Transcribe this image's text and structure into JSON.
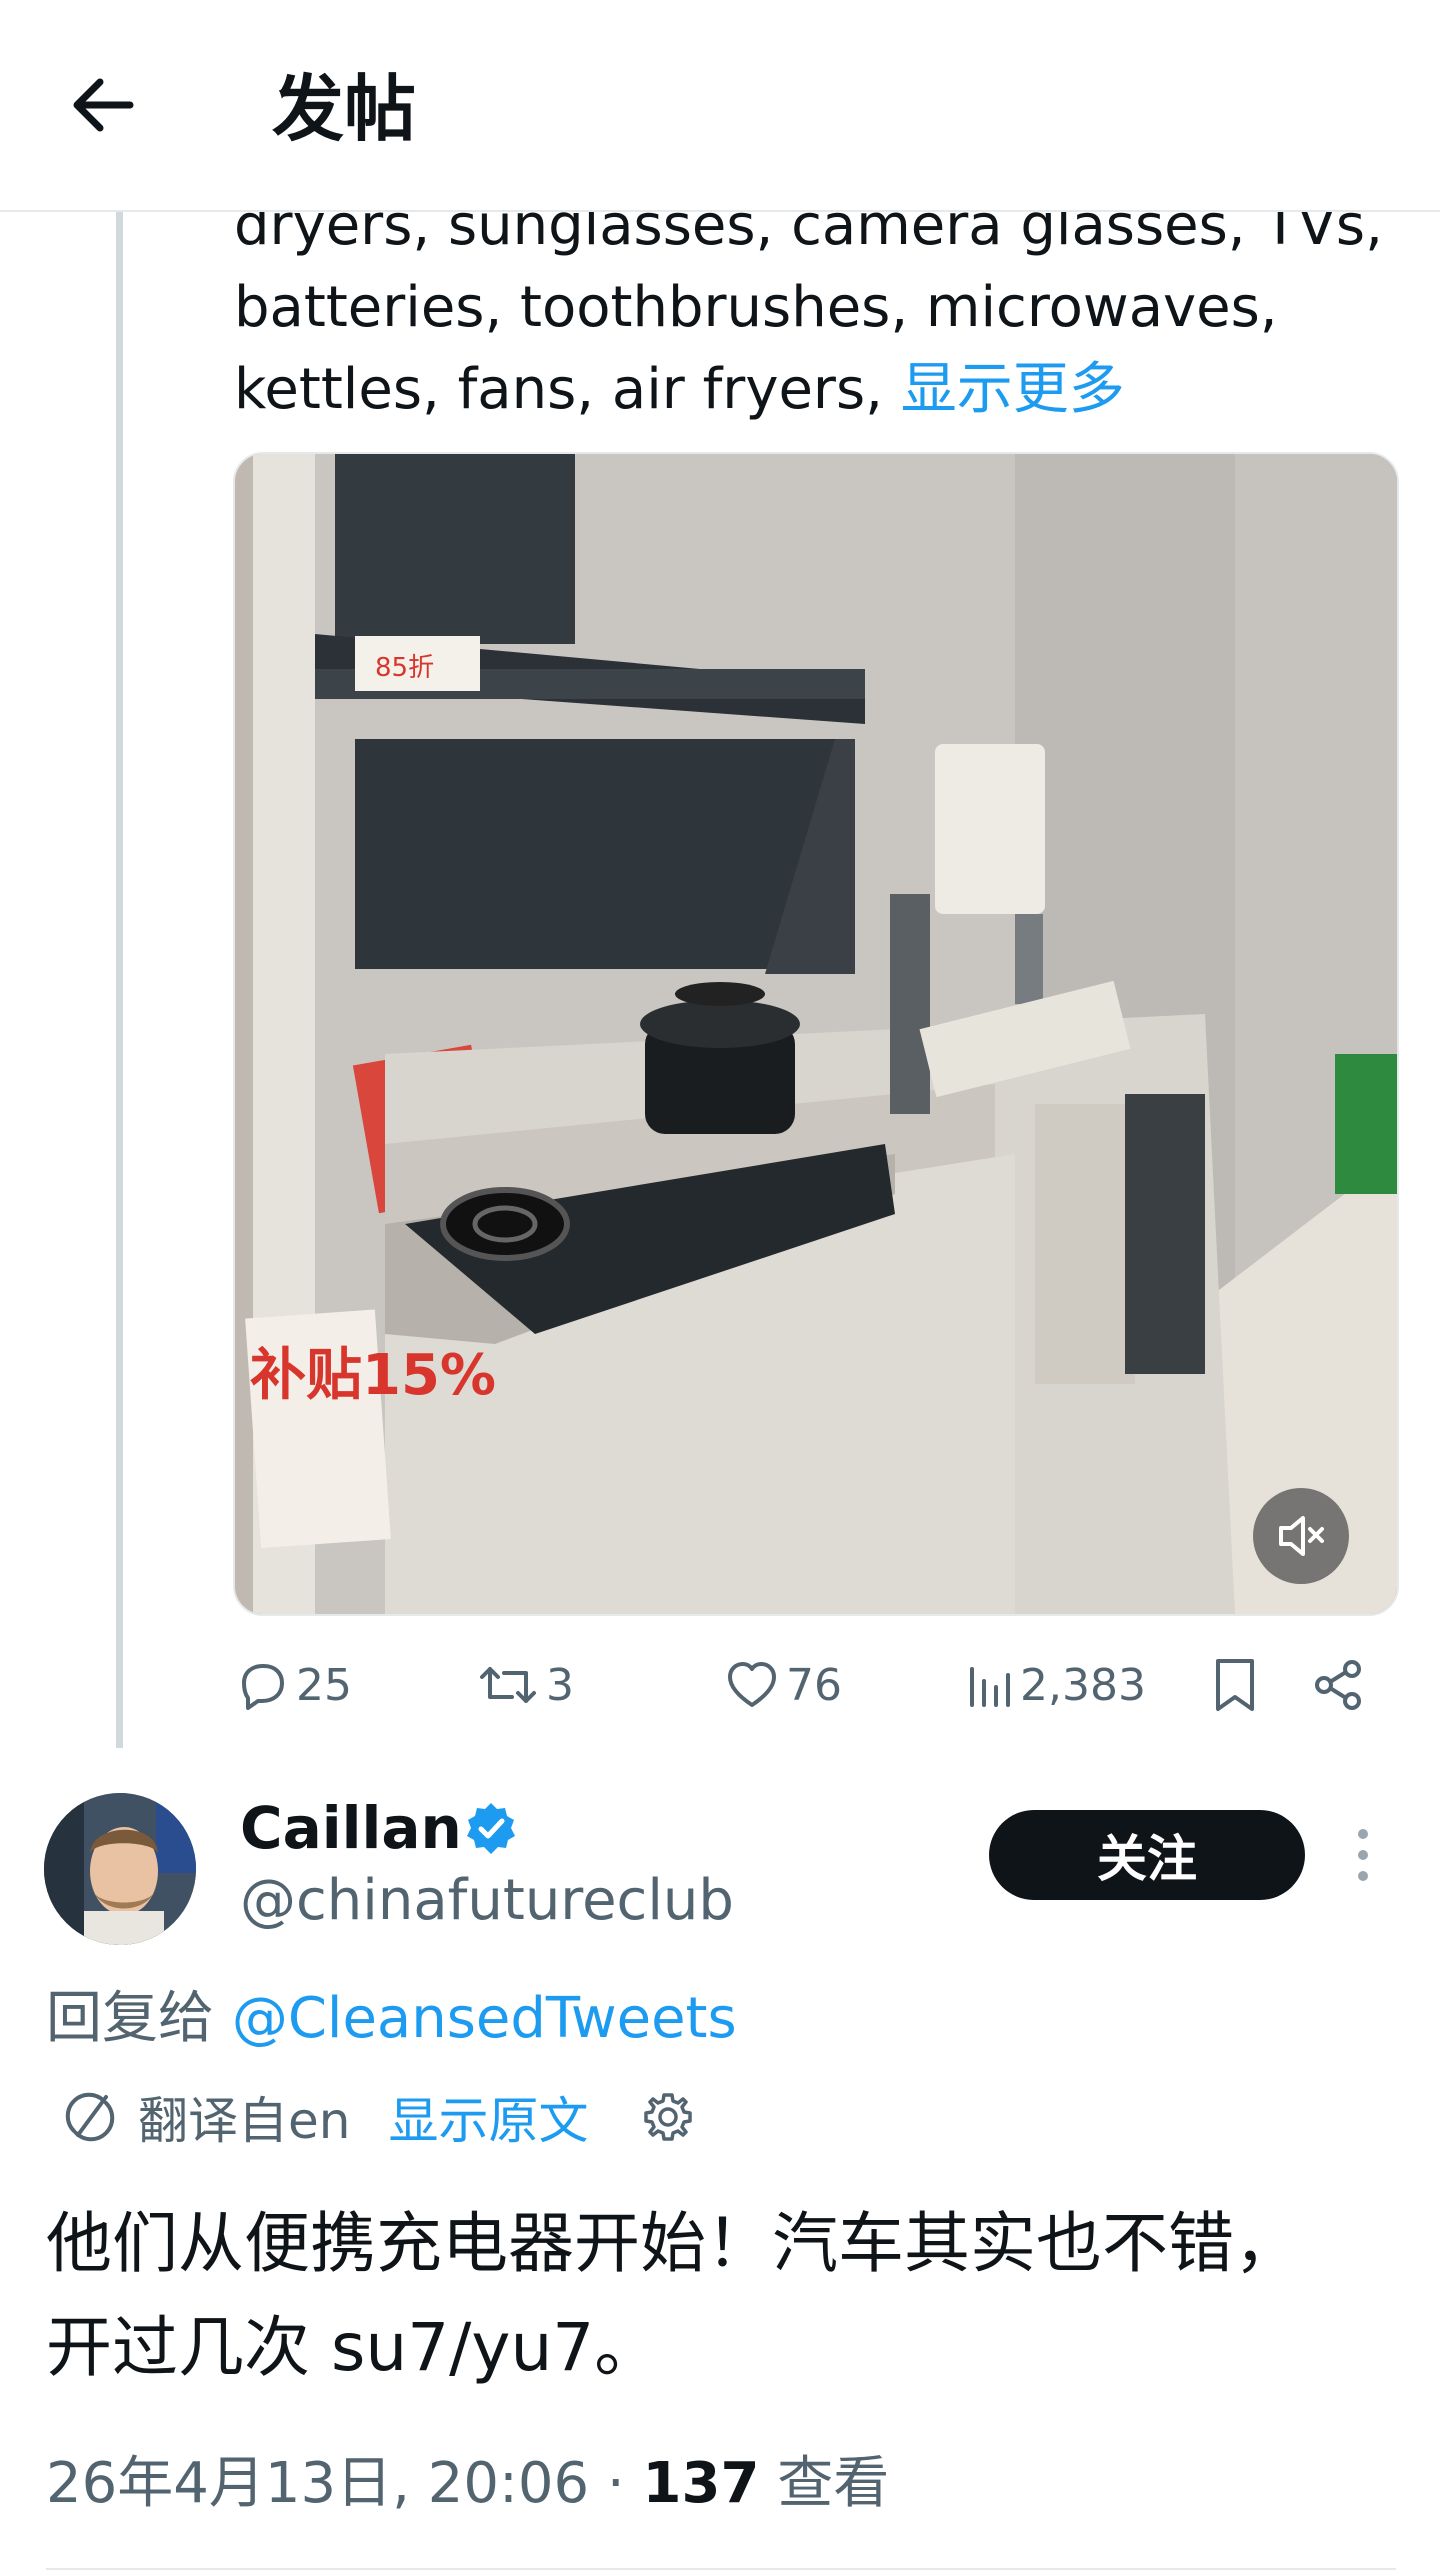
{
  "header": {
    "title": "发帖"
  },
  "post": {
    "text_lines": [
      "dryers, sunglasses, camera glasses, TVs,",
      "batteries, toothbrushes, microwaves,",
      "kettles, fans, air fryers, "
    ],
    "show_more": "显示更多",
    "media": {
      "price_tag": "85折",
      "sticker": "补贴15%"
    },
    "actions": {
      "replies": "25",
      "reposts": "3",
      "likes": "76",
      "views": "2,383"
    }
  },
  "reply": {
    "author_name": "Caillan",
    "author_handle": "@chinafutureclub",
    "follow_label": "关注",
    "reply_to_prefix": "回复给 ",
    "reply_to_handle": "@CleansedTweets",
    "translated_from": "翻译自en",
    "show_original": "显示原文",
    "text_line1": "他们从便携充电器开始！汽车其实也不错，",
    "text_line2": "开过几次 su7/yu7。",
    "timestamp": "26年4月13日, 20:06 · ",
    "views_count": "137",
    "views_label": " 查看"
  },
  "colors": {
    "accent": "#1d9bf0",
    "text": "#0f1419",
    "secondary": "#536471",
    "verified": "#1d9bf0"
  },
  "icons": [
    "back-arrow-icon",
    "mute-icon",
    "reply-icon",
    "repost-icon",
    "like-icon",
    "views-icon",
    "bookmark-icon",
    "share-icon",
    "verified-icon",
    "more-icon",
    "translate-icon",
    "gear-icon"
  ]
}
